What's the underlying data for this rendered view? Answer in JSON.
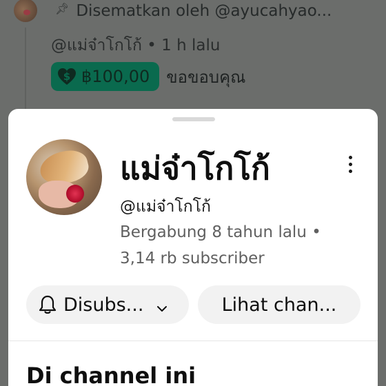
{
  "comment": {
    "pinned_text": "Disematkan oleh @ayucahyao...",
    "author_meta": "@แม่จ๋าโกโก้ • 1 h lalu",
    "supers_amount": "฿100,00",
    "supers_message": "ขอขอบคุณ"
  },
  "channel": {
    "name": "แม่จ๋าโกโก้",
    "handle": "@แม่จ๋าโกโก้",
    "joined": "Bergabung 8 tahun lalu •",
    "subscribers": "3,14 rb subscriber",
    "subscribe_label": "Disubs...",
    "view_channel_label": "Lihat chan...",
    "section_title": "Di channel ini"
  },
  "icons": {
    "pin": "pin-icon",
    "supers": "heart-dollar-icon",
    "bell": "bell-icon",
    "chevron": "chevron-down-icon",
    "more": "more-vertical-icon"
  },
  "colors": {
    "supers_chip": "#0a6a4e",
    "sheet_bg": "#ffffff",
    "button_bg": "#f2f2f2",
    "secondary_text": "#606060"
  }
}
